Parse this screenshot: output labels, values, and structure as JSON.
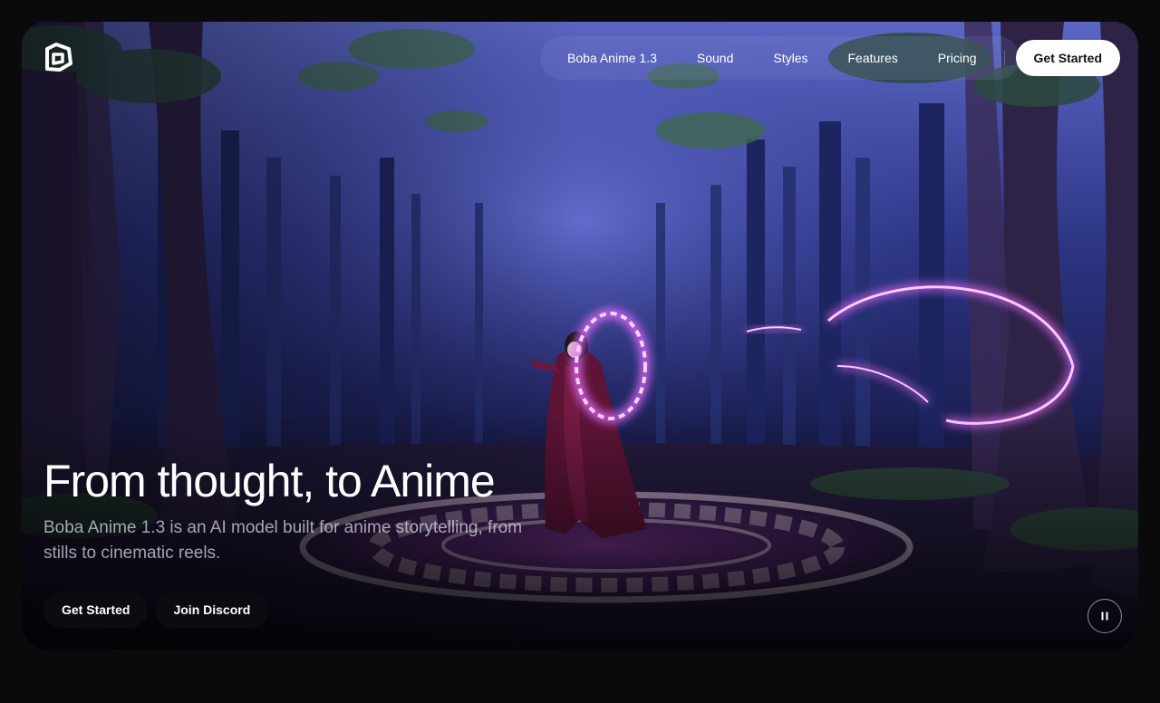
{
  "nav": {
    "items": [
      {
        "label": "Boba Anime 1.3"
      },
      {
        "label": "Sound"
      },
      {
        "label": "Styles"
      },
      {
        "label": "Features"
      },
      {
        "label": "Pricing"
      }
    ],
    "cta_label": "Get Started"
  },
  "hero": {
    "title": "From thought, to Anime",
    "subtitle": "Boba Anime 1.3 is an AI model built for anime storytelling, from stills to cinematic reels.",
    "buttons": {
      "primary": "Get Started",
      "secondary": "Join Discord"
    }
  },
  "icons": {
    "logo": "boba-logo-icon",
    "pause": "pause-icon"
  },
  "colors": {
    "page_bg": "#0a0a0c",
    "accent_glow": "#e56cff",
    "night_sky": "#3f4aa8"
  }
}
